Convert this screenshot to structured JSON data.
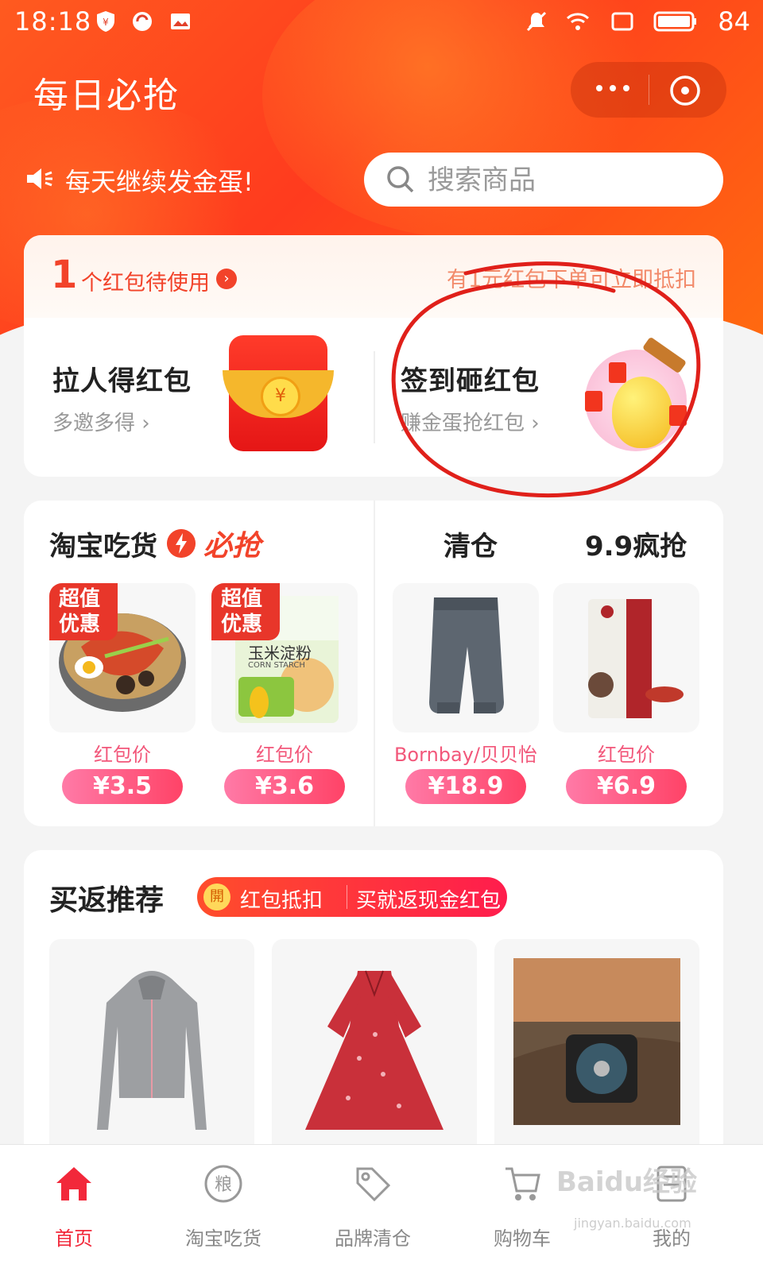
{
  "status": {
    "time": "18:18",
    "battery": "84"
  },
  "header": {
    "title": "每日必抢",
    "notice": "每天继续发金蛋!",
    "search_placeholder": "搜索商品"
  },
  "red_packet": {
    "count": "1",
    "count_label": "个红包待使用",
    "right_text": "有1元红包下单可立即抵扣",
    "actions": [
      {
        "title": "拉人得红包",
        "sub": "多邀多得 ›"
      },
      {
        "title": "签到砸红包",
        "sub": "赚金蛋抢红包 ›"
      }
    ]
  },
  "deals": {
    "left_title": "淘宝吃货",
    "left_tag": "必抢",
    "right_titles": [
      "清仓",
      "9.9疯抢"
    ],
    "products": [
      {
        "tag": "超值优惠",
        "label": "红包价",
        "price": "¥3.5"
      },
      {
        "tag": "超值优惠",
        "label": "红包价",
        "price": "¥3.6",
        "pack_text": "玉米淀粉",
        "pack_sub": "CORN STARCH"
      },
      {
        "label": "Bornbay/贝贝怡",
        "price": "¥18.9"
      },
      {
        "label": "红包价",
        "price": "¥6.9"
      }
    ]
  },
  "recommend": {
    "title": "买返推荐",
    "badge_coin": "開",
    "badge_a": "红包抵扣",
    "badge_b": "买就返现金红包"
  },
  "tabs": [
    {
      "label": "首页",
      "icon": "home-icon",
      "active": true
    },
    {
      "label": "淘宝吃货",
      "icon": "grain-icon",
      "icon_char": "粮"
    },
    {
      "label": "品牌清仓",
      "icon": "tag-icon"
    },
    {
      "label": "购物车",
      "icon": "cart-icon"
    },
    {
      "label": "我的",
      "icon": "profile-icon"
    }
  ],
  "watermark": {
    "main": "Baidu经验",
    "sub": "jingyan.baidu.com"
  },
  "colors": {
    "accent": "#f2283a",
    "header": "#ff4a1e",
    "price_pill": "#ff4367"
  }
}
